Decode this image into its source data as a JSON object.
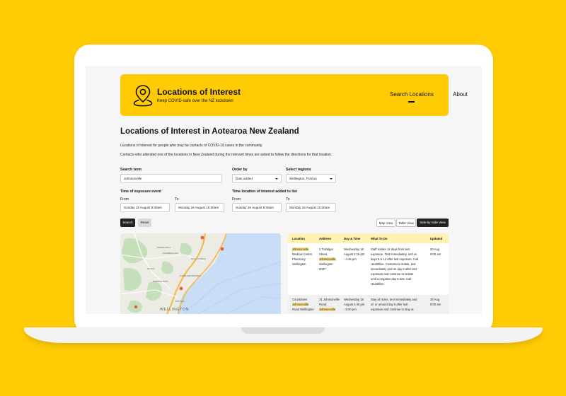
{
  "header": {
    "title": "Locations of Interest",
    "tagline": "Keep COVID-safe over the NZ lockdown",
    "logo_icon": "map-pin-icon",
    "nav": {
      "search_label": "Search Locations",
      "about_label": "About"
    }
  },
  "page": {
    "title": "Locations of Interest in Aotearoa New Zealand",
    "intro1": "Locations of interest for people who may be contacts of COVID-19 cases in the community.",
    "intro2": "Contacts who attended one of the locations in New Zealand during the relevant times are asked to follow the directions for that location."
  },
  "form": {
    "search_term_label": "Search term",
    "search_term_value": "Johnsonville",
    "order_by_label": "Order by",
    "order_by_value": "Date added",
    "regions_label": "Select regions",
    "regions_value": "Wellington, Porirua",
    "exposure_label": "Time of exposure event",
    "exposure_from_label": "From",
    "exposure_from_value": "Sunday 15 August 9:30am",
    "exposure_to_label": "To",
    "exposure_to_value": "Monday 16 August 10:30am",
    "added_label": "Time location of interest added to list",
    "added_from_label": "From",
    "added_from_value": "Sunday 15 August 9:30am",
    "added_to_label": "To",
    "added_to_value": "Monday 16 August 10:30am",
    "search_button": "Search",
    "reset_button": "Reset"
  },
  "views": {
    "map_view": "Map View",
    "table_view": "Table View",
    "side_view": "Side-by-Side View",
    "active": "Side-by-Side View"
  },
  "map": {
    "labels": [
      "PAPARANGI",
      "KHANDALLAH",
      "NGAURANGA",
      "NGAIO",
      "WADESTOWN",
      "KAIWHARAWHARA",
      "PIPITEA"
    ],
    "city": "WELLINGTON",
    "water_color": "#c9ddf6",
    "land_color": "#ecece4",
    "green_color": "#c6dfbb",
    "road_color": "#f2b84b"
  },
  "table": {
    "columns": [
      "Location",
      "Address",
      "Day & Time",
      "What To Do",
      "Updated"
    ],
    "highlight_color": "#ffe487",
    "header_color": "#fff2b3",
    "rows": [
      {
        "location": [
          "Johnsonville",
          "Medical Centre",
          "Pharmacy",
          "Wellington"
        ],
        "address": [
          "2 Trafalgar",
          "Street,",
          "Johnsonville,",
          "Wellington",
          "6037"
        ],
        "time": [
          "Wednesday 18",
          "August 4:15 pm",
          "- 4:45 pm"
        ],
        "todo": [
          "Staff isolate 14 days from last",
          "exposure. Test immediately, and on",
          "days 5 & 12 after last exposure. Call",
          "Healthline. Customers isolate, test",
          "immediately and on day 5 after last",
          "exposure and continue to isolate",
          "until a negative day 5 test. Call",
          "Healthline."
        ],
        "updated": [
          "20 Aug",
          "9:00 am"
        ]
      },
      {
        "location": [
          "Countdown",
          "Johnsonville",
          "Road Wellington"
        ],
        "address": [
          "31 Johnsonville",
          "Road,",
          "Johnsonville"
        ],
        "time": [
          "Wednesday 18",
          "August 4:45 pm",
          "- 5:00 pm"
        ],
        "todo": [
          "Stay at home, test immediately and",
          "on or around day 5 after last",
          "exposure and continue to stay at"
        ],
        "updated": [
          "20 Aug",
          "9:00 am"
        ]
      }
    ]
  }
}
